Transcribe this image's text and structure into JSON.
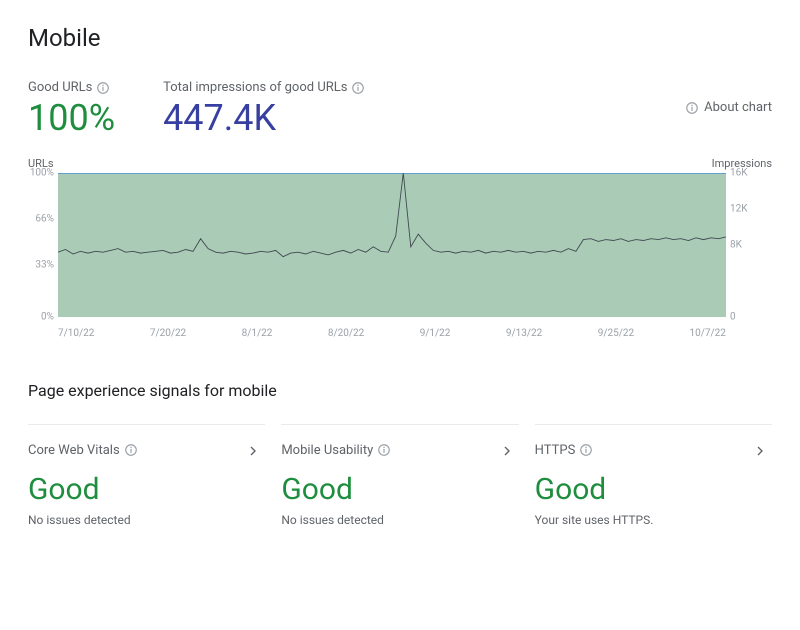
{
  "title": "Mobile",
  "metrics": {
    "good_urls_label": "Good URLs",
    "good_urls_value": "100%",
    "impressions_label": "Total impressions of good URLs",
    "impressions_value": "447.4K"
  },
  "about_chart_label": "About chart",
  "chart_data": {
    "type": "line",
    "y_left_label": "URLs",
    "y_right_label": "Impressions",
    "y_left_ticks": [
      "100%",
      "66%",
      "33%",
      "0%"
    ],
    "y_right_ticks": [
      "16K",
      "12K",
      "8K",
      "0"
    ],
    "x_ticks": [
      "7/10/22",
      "7/20/22",
      "8/1/22",
      "8/20/22",
      "9/1/22",
      "9/13/22",
      "9/25/22",
      "10/7/22"
    ],
    "ylim_left": [
      0,
      100
    ],
    "ylim_right": [
      0,
      16000
    ],
    "series": [
      {
        "name": "Good URLs %",
        "color": "#1a73e8",
        "values": [
          100,
          100,
          100,
          100,
          100,
          100,
          100,
          100,
          100,
          100,
          100,
          100,
          100,
          100,
          100,
          100,
          100,
          100,
          100,
          100,
          100,
          100,
          100,
          100,
          100,
          100,
          100,
          100,
          100,
          100,
          100,
          100,
          100,
          100,
          100,
          100,
          100,
          100,
          100,
          100,
          100,
          100,
          100,
          100,
          100,
          100,
          100,
          100,
          100,
          100,
          100,
          100,
          100,
          100,
          100,
          100,
          100,
          100,
          100,
          100,
          100,
          100,
          100,
          100,
          100,
          100,
          100,
          100,
          100,
          100,
          100,
          100,
          100,
          100,
          100,
          100,
          100,
          100,
          100,
          100,
          100,
          100,
          100,
          100,
          100,
          100,
          100,
          100,
          100,
          100
        ]
      },
      {
        "name": "Impressions",
        "color": "#414a52",
        "values": [
          7200,
          7500,
          7000,
          7300,
          7100,
          7300,
          7200,
          7400,
          7600,
          7200,
          7300,
          7100,
          7200,
          7300,
          7400,
          7100,
          7200,
          7500,
          7300,
          8700,
          7600,
          7200,
          7100,
          7300,
          7200,
          7000,
          7100,
          7300,
          7200,
          7400,
          6700,
          7100,
          7200,
          7000,
          7300,
          7100,
          6900,
          7200,
          7400,
          7100,
          7500,
          7200,
          7800,
          7300,
          7200,
          9000,
          16000,
          7800,
          9200,
          8200,
          7400,
          7200,
          7300,
          7100,
          7300,
          7200,
          7400,
          7100,
          7300,
          7200,
          7400,
          7200,
          7300,
          7100,
          7300,
          7200,
          7400,
          7200,
          7600,
          7300,
          8600,
          8700,
          8400,
          8600,
          8500,
          8700,
          8400,
          8600,
          8500,
          8700,
          8600,
          8800,
          8600,
          8700,
          8500,
          8800,
          8600,
          8800,
          8700,
          8900
        ]
      }
    ]
  },
  "signals": {
    "heading": "Page experience signals for mobile",
    "cards": [
      {
        "title": "Core Web Vitals",
        "status": "Good",
        "sub": "No issues detected"
      },
      {
        "title": "Mobile Usability",
        "status": "Good",
        "sub": "No issues detected"
      },
      {
        "title": "HTTPS",
        "status": "Good",
        "sub": "Your site uses HTTPS."
      }
    ]
  }
}
